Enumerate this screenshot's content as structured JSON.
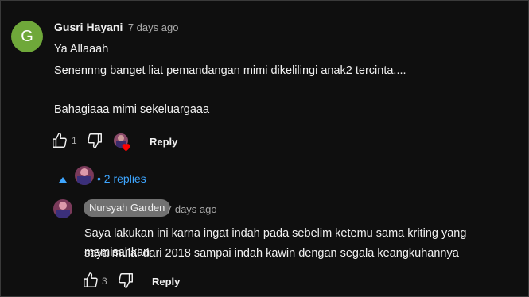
{
  "comment": {
    "avatar_letter": "G",
    "avatar_color": "#6fa83a",
    "author": "Gusri Hayani",
    "time": "7 days ago",
    "lines": [
      "Ya Allaaah",
      "Senennng banget liat pemandangan mimi  dikelilingi anak2 tercinta....",
      "Bahagiaaa mimi sekeluargaaa"
    ],
    "like_count": "1",
    "reply_label": "Reply",
    "replies_toggle": "2 replies"
  },
  "reply": {
    "author_chip": "Nursyah Garden",
    "time": "7 days ago",
    "lines": [
      "Saya lakukan ini karna ingat indah pada sebelim ketemu sama kriting yang memisahkan",
      "saya mulai dari 2018 sampai indah kawin dengan segala keangkuhannya"
    ],
    "like_count": "3",
    "reply_label": "Reply"
  },
  "colors": {
    "background": "#0f0f0f",
    "link": "#3ea6ff",
    "heart": "#ff0000"
  }
}
